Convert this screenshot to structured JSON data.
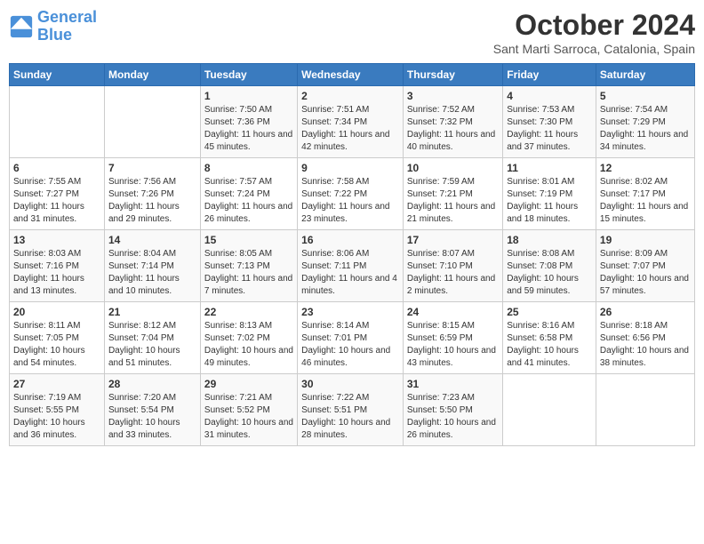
{
  "logo": {
    "line1": "General",
    "line2": "Blue"
  },
  "title": "October 2024",
  "subtitle": "Sant Marti Sarroca, Catalonia, Spain",
  "weekdays": [
    "Sunday",
    "Monday",
    "Tuesday",
    "Wednesday",
    "Thursday",
    "Friday",
    "Saturday"
  ],
  "weeks": [
    [
      {
        "day": "",
        "info": ""
      },
      {
        "day": "",
        "info": ""
      },
      {
        "day": "1",
        "info": "Sunrise: 7:50 AM\nSunset: 7:36 PM\nDaylight: 11 hours and 45 minutes."
      },
      {
        "day": "2",
        "info": "Sunrise: 7:51 AM\nSunset: 7:34 PM\nDaylight: 11 hours and 42 minutes."
      },
      {
        "day": "3",
        "info": "Sunrise: 7:52 AM\nSunset: 7:32 PM\nDaylight: 11 hours and 40 minutes."
      },
      {
        "day": "4",
        "info": "Sunrise: 7:53 AM\nSunset: 7:30 PM\nDaylight: 11 hours and 37 minutes."
      },
      {
        "day": "5",
        "info": "Sunrise: 7:54 AM\nSunset: 7:29 PM\nDaylight: 11 hours and 34 minutes."
      }
    ],
    [
      {
        "day": "6",
        "info": "Sunrise: 7:55 AM\nSunset: 7:27 PM\nDaylight: 11 hours and 31 minutes."
      },
      {
        "day": "7",
        "info": "Sunrise: 7:56 AM\nSunset: 7:26 PM\nDaylight: 11 hours and 29 minutes."
      },
      {
        "day": "8",
        "info": "Sunrise: 7:57 AM\nSunset: 7:24 PM\nDaylight: 11 hours and 26 minutes."
      },
      {
        "day": "9",
        "info": "Sunrise: 7:58 AM\nSunset: 7:22 PM\nDaylight: 11 hours and 23 minutes."
      },
      {
        "day": "10",
        "info": "Sunrise: 7:59 AM\nSunset: 7:21 PM\nDaylight: 11 hours and 21 minutes."
      },
      {
        "day": "11",
        "info": "Sunrise: 8:01 AM\nSunset: 7:19 PM\nDaylight: 11 hours and 18 minutes."
      },
      {
        "day": "12",
        "info": "Sunrise: 8:02 AM\nSunset: 7:17 PM\nDaylight: 11 hours and 15 minutes."
      }
    ],
    [
      {
        "day": "13",
        "info": "Sunrise: 8:03 AM\nSunset: 7:16 PM\nDaylight: 11 hours and 13 minutes."
      },
      {
        "day": "14",
        "info": "Sunrise: 8:04 AM\nSunset: 7:14 PM\nDaylight: 11 hours and 10 minutes."
      },
      {
        "day": "15",
        "info": "Sunrise: 8:05 AM\nSunset: 7:13 PM\nDaylight: 11 hours and 7 minutes."
      },
      {
        "day": "16",
        "info": "Sunrise: 8:06 AM\nSunset: 7:11 PM\nDaylight: 11 hours and 4 minutes."
      },
      {
        "day": "17",
        "info": "Sunrise: 8:07 AM\nSunset: 7:10 PM\nDaylight: 11 hours and 2 minutes."
      },
      {
        "day": "18",
        "info": "Sunrise: 8:08 AM\nSunset: 7:08 PM\nDaylight: 10 hours and 59 minutes."
      },
      {
        "day": "19",
        "info": "Sunrise: 8:09 AM\nSunset: 7:07 PM\nDaylight: 10 hours and 57 minutes."
      }
    ],
    [
      {
        "day": "20",
        "info": "Sunrise: 8:11 AM\nSunset: 7:05 PM\nDaylight: 10 hours and 54 minutes."
      },
      {
        "day": "21",
        "info": "Sunrise: 8:12 AM\nSunset: 7:04 PM\nDaylight: 10 hours and 51 minutes."
      },
      {
        "day": "22",
        "info": "Sunrise: 8:13 AM\nSunset: 7:02 PM\nDaylight: 10 hours and 49 minutes."
      },
      {
        "day": "23",
        "info": "Sunrise: 8:14 AM\nSunset: 7:01 PM\nDaylight: 10 hours and 46 minutes."
      },
      {
        "day": "24",
        "info": "Sunrise: 8:15 AM\nSunset: 6:59 PM\nDaylight: 10 hours and 43 minutes."
      },
      {
        "day": "25",
        "info": "Sunrise: 8:16 AM\nSunset: 6:58 PM\nDaylight: 10 hours and 41 minutes."
      },
      {
        "day": "26",
        "info": "Sunrise: 8:18 AM\nSunset: 6:56 PM\nDaylight: 10 hours and 38 minutes."
      }
    ],
    [
      {
        "day": "27",
        "info": "Sunrise: 7:19 AM\nSunset: 5:55 PM\nDaylight: 10 hours and 36 minutes."
      },
      {
        "day": "28",
        "info": "Sunrise: 7:20 AM\nSunset: 5:54 PM\nDaylight: 10 hours and 33 minutes."
      },
      {
        "day": "29",
        "info": "Sunrise: 7:21 AM\nSunset: 5:52 PM\nDaylight: 10 hours and 31 minutes."
      },
      {
        "day": "30",
        "info": "Sunrise: 7:22 AM\nSunset: 5:51 PM\nDaylight: 10 hours and 28 minutes."
      },
      {
        "day": "31",
        "info": "Sunrise: 7:23 AM\nSunset: 5:50 PM\nDaylight: 10 hours and 26 minutes."
      },
      {
        "day": "",
        "info": ""
      },
      {
        "day": "",
        "info": ""
      }
    ]
  ]
}
